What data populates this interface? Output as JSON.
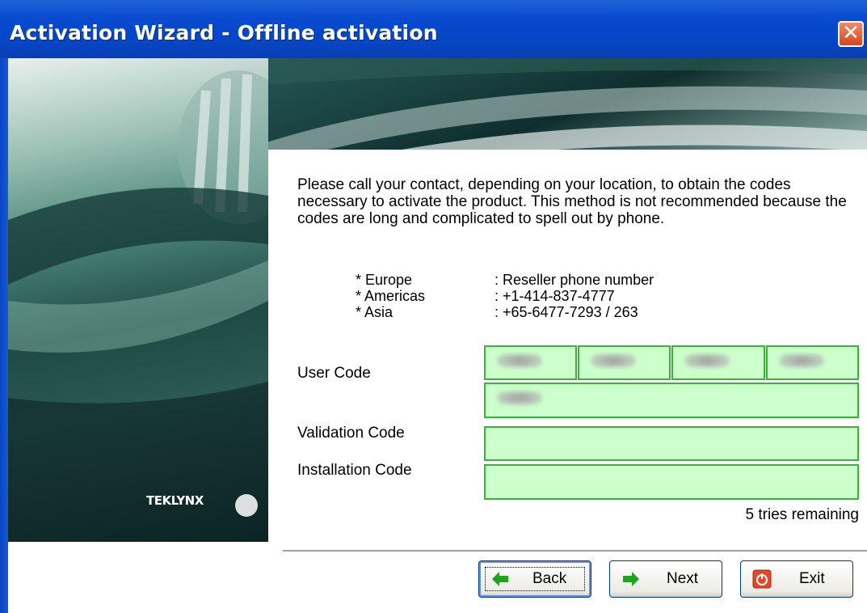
{
  "window": {
    "title": "Activation Wizard - Offline activation",
    "close_glyph": "✕"
  },
  "brand": {
    "logo_text": "TEKLYNX"
  },
  "intro": {
    "text": "Please call your contact, depending on your location, to obtain the codes necessary to activate the product. This method is not recommended because the codes are long and complicated to spell out by phone."
  },
  "contacts": [
    {
      "region": "* Europe",
      "number": ": Reseller phone number"
    },
    {
      "region": "* Americas",
      "number": ": +1-414-837-4777"
    },
    {
      "region": "* Asia",
      "number": ": +65-6477-7293 / 263"
    }
  ],
  "form": {
    "user_code_label": "User Code",
    "validation_code_label": "Validation Code",
    "installation_code_label": "Installation Code",
    "validation_code_value": "",
    "installation_code_value": "",
    "field_color": "#ccffcc"
  },
  "status": {
    "tries_remaining": "5 tries remaining"
  },
  "buttons": {
    "back": "Back",
    "next": "Next",
    "exit": "Exit"
  },
  "icons": {
    "back": "left-arrow-icon",
    "next": "right-arrow-icon",
    "exit": "power-icon"
  }
}
